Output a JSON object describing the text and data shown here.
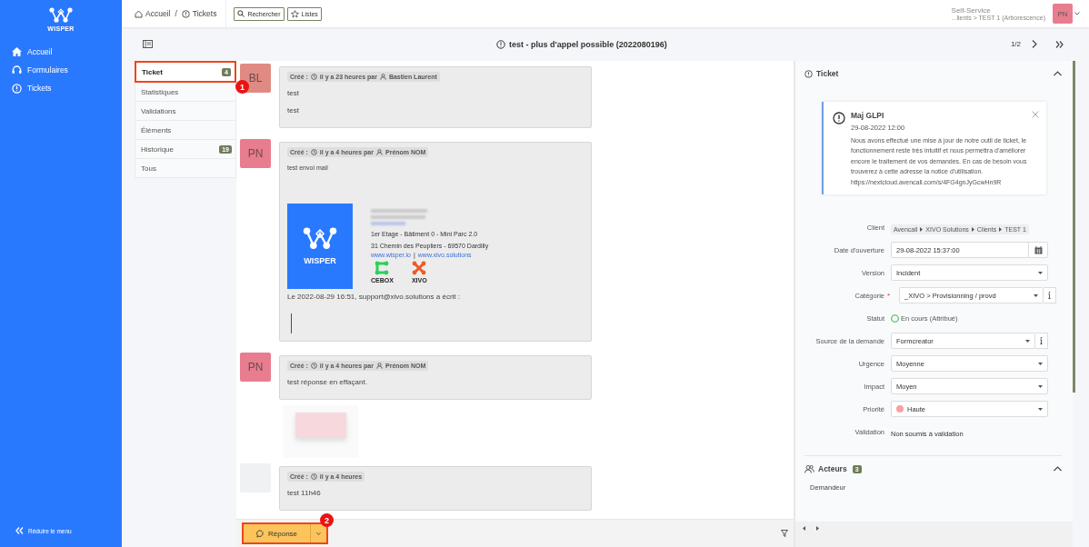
{
  "sidebar": {
    "logo_text": "WISPER",
    "items": [
      {
        "label": "Accueil"
      },
      {
        "label": "Formulaires"
      },
      {
        "label": "Tickets"
      }
    ],
    "collapse": "Réduire le menu"
  },
  "header": {
    "breadcrumb": [
      "Accueil",
      "Tickets"
    ],
    "separator": "/",
    "buttons": [
      {
        "label": "Rechercher"
      },
      {
        "label": "Listes"
      }
    ],
    "profile": "Self-Service",
    "entity": "...lients > TEST 1 (Arborescence)",
    "avatar": "PN"
  },
  "ticket": {
    "title": "test - plus d'appel possible (2022080196)",
    "pager": "1/2"
  },
  "tabs": [
    {
      "label": "Ticket",
      "selected": true,
      "badge": "4",
      "callout": "1"
    },
    {
      "label": "Statistiques",
      "selected": false
    },
    {
      "label": "Validations",
      "selected": false
    },
    {
      "label": "Éléments",
      "selected": false
    },
    {
      "label": "Historique",
      "selected": false,
      "badge": "19"
    },
    {
      "label": "Tous",
      "selected": false
    }
  ],
  "timeline": [
    {
      "kind": "text",
      "initials": "BL",
      "color": "#e08a84",
      "created": "Créé :",
      "time": "il y a 23 heures par",
      "author": "Bastien Laurent",
      "lines": [
        "test",
        "test"
      ]
    },
    {
      "kind": "email",
      "initials": "PN",
      "color": "#e87d8f",
      "created": "Créé :",
      "time": "il y a 4 heures par",
      "author": "Prénom NOM",
      "lines": [
        "test envoi mail"
      ],
      "signature": {
        "logo_text": "WISPER",
        "address": [
          "1er Etage - Bâtiment 0 - Mini Parc 2.0",
          "31 Chemin des Peupliers - 69570 Dardilly"
        ],
        "links": [
          "www.wisper.io",
          "www.xivo.solutions"
        ],
        "link_separator": "|",
        "brands": [
          "CEBOX",
          "XIVO"
        ]
      },
      "quote_header": "Le 2022-08-29 16:51, support@xivo.solutions a écrit :"
    },
    {
      "kind": "text",
      "initials": "PN",
      "color": "#e87d8f",
      "created": "Créé :",
      "time": "il y a 4 heures par",
      "author": "Prénom NOM",
      "lines": [
        "test réponse en effaçant."
      ]
    },
    {
      "kind": "image"
    },
    {
      "kind": "text",
      "color": "#f0f1f3",
      "created": "Créé :",
      "time": "il y a 4 heures",
      "lines": [
        "test 11h46"
      ]
    }
  ],
  "reply_button": {
    "label": "Réponse",
    "callout": "2"
  },
  "panel": {
    "title": "Ticket",
    "alert": {
      "title": "Maj GLPI",
      "date": "29-08-2022 12:00",
      "body": "Nous avons effectué une mise à jour de notre outil de ticket, le fonctionnement reste très intuitif et nous permettra d'améliorer encore le traitement de vos demandes. En cas de besoin vous trouverez à cette adresse la notice d'utilisation. https://nextcloud.avencall.com/s/4FG4gnJyGcwHn9R"
    },
    "fields": [
      {
        "kind": "path",
        "label": "Client",
        "path": [
          "Avencall",
          "XIVO Solutions",
          "Clients",
          "TEST 1"
        ]
      },
      {
        "kind": "date",
        "label": "Date d'ouverture",
        "value": "29-08-2022 15:37:00"
      },
      {
        "kind": "select",
        "label": "Version",
        "value": "Incident"
      },
      {
        "kind": "select-info",
        "label": "Catégorie",
        "required_mark": "*",
        "value": "_XIVO > Provisionning / provd"
      },
      {
        "kind": "status",
        "label": "Statut",
        "value": "En cours (Attribué)"
      },
      {
        "kind": "select-info",
        "label": "Source de la demande",
        "value": "Formcreator"
      },
      {
        "kind": "select",
        "label": "Urgence",
        "value": "Moyenne"
      },
      {
        "kind": "select",
        "label": "Impact",
        "value": "Moyen"
      },
      {
        "kind": "priority",
        "label": "Priorité",
        "value": "Haute",
        "color": "#f7a1a1"
      },
      {
        "kind": "text",
        "label": "Validation",
        "value": "Non soumis à validation"
      }
    ],
    "actors": {
      "title": "Acteurs",
      "badge": "3",
      "first_label": "Demandeur"
    }
  }
}
